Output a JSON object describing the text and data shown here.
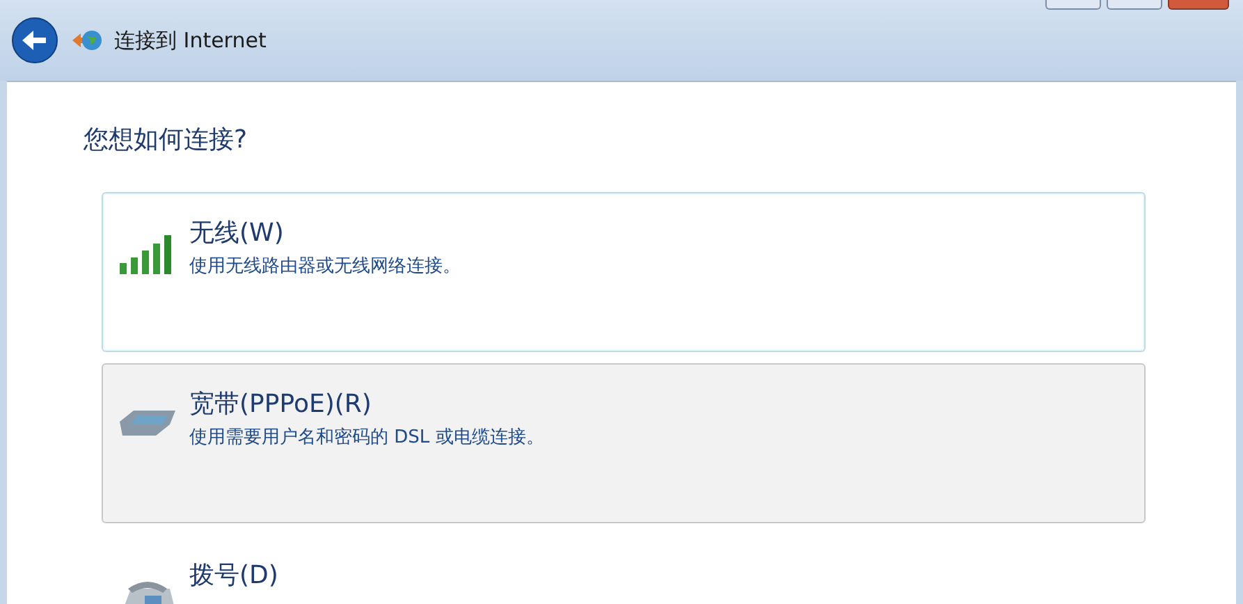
{
  "window": {
    "title": "连接到 Internet"
  },
  "heading": "您想如何连接?",
  "options": [
    {
      "kind": "wireless",
      "title": "无线(W)",
      "description": "使用无线路由器或无线网络连接。",
      "focused": true,
      "highlighted": false
    },
    {
      "kind": "broadband",
      "title": "宽带(PPPoE)(R)",
      "description": "使用需要用户名和密码的 DSL 或电缆连接。",
      "focused": false,
      "highlighted": true
    },
    {
      "kind": "dialup",
      "title": "拨号(D)",
      "focused": false,
      "highlighted": false
    }
  ]
}
